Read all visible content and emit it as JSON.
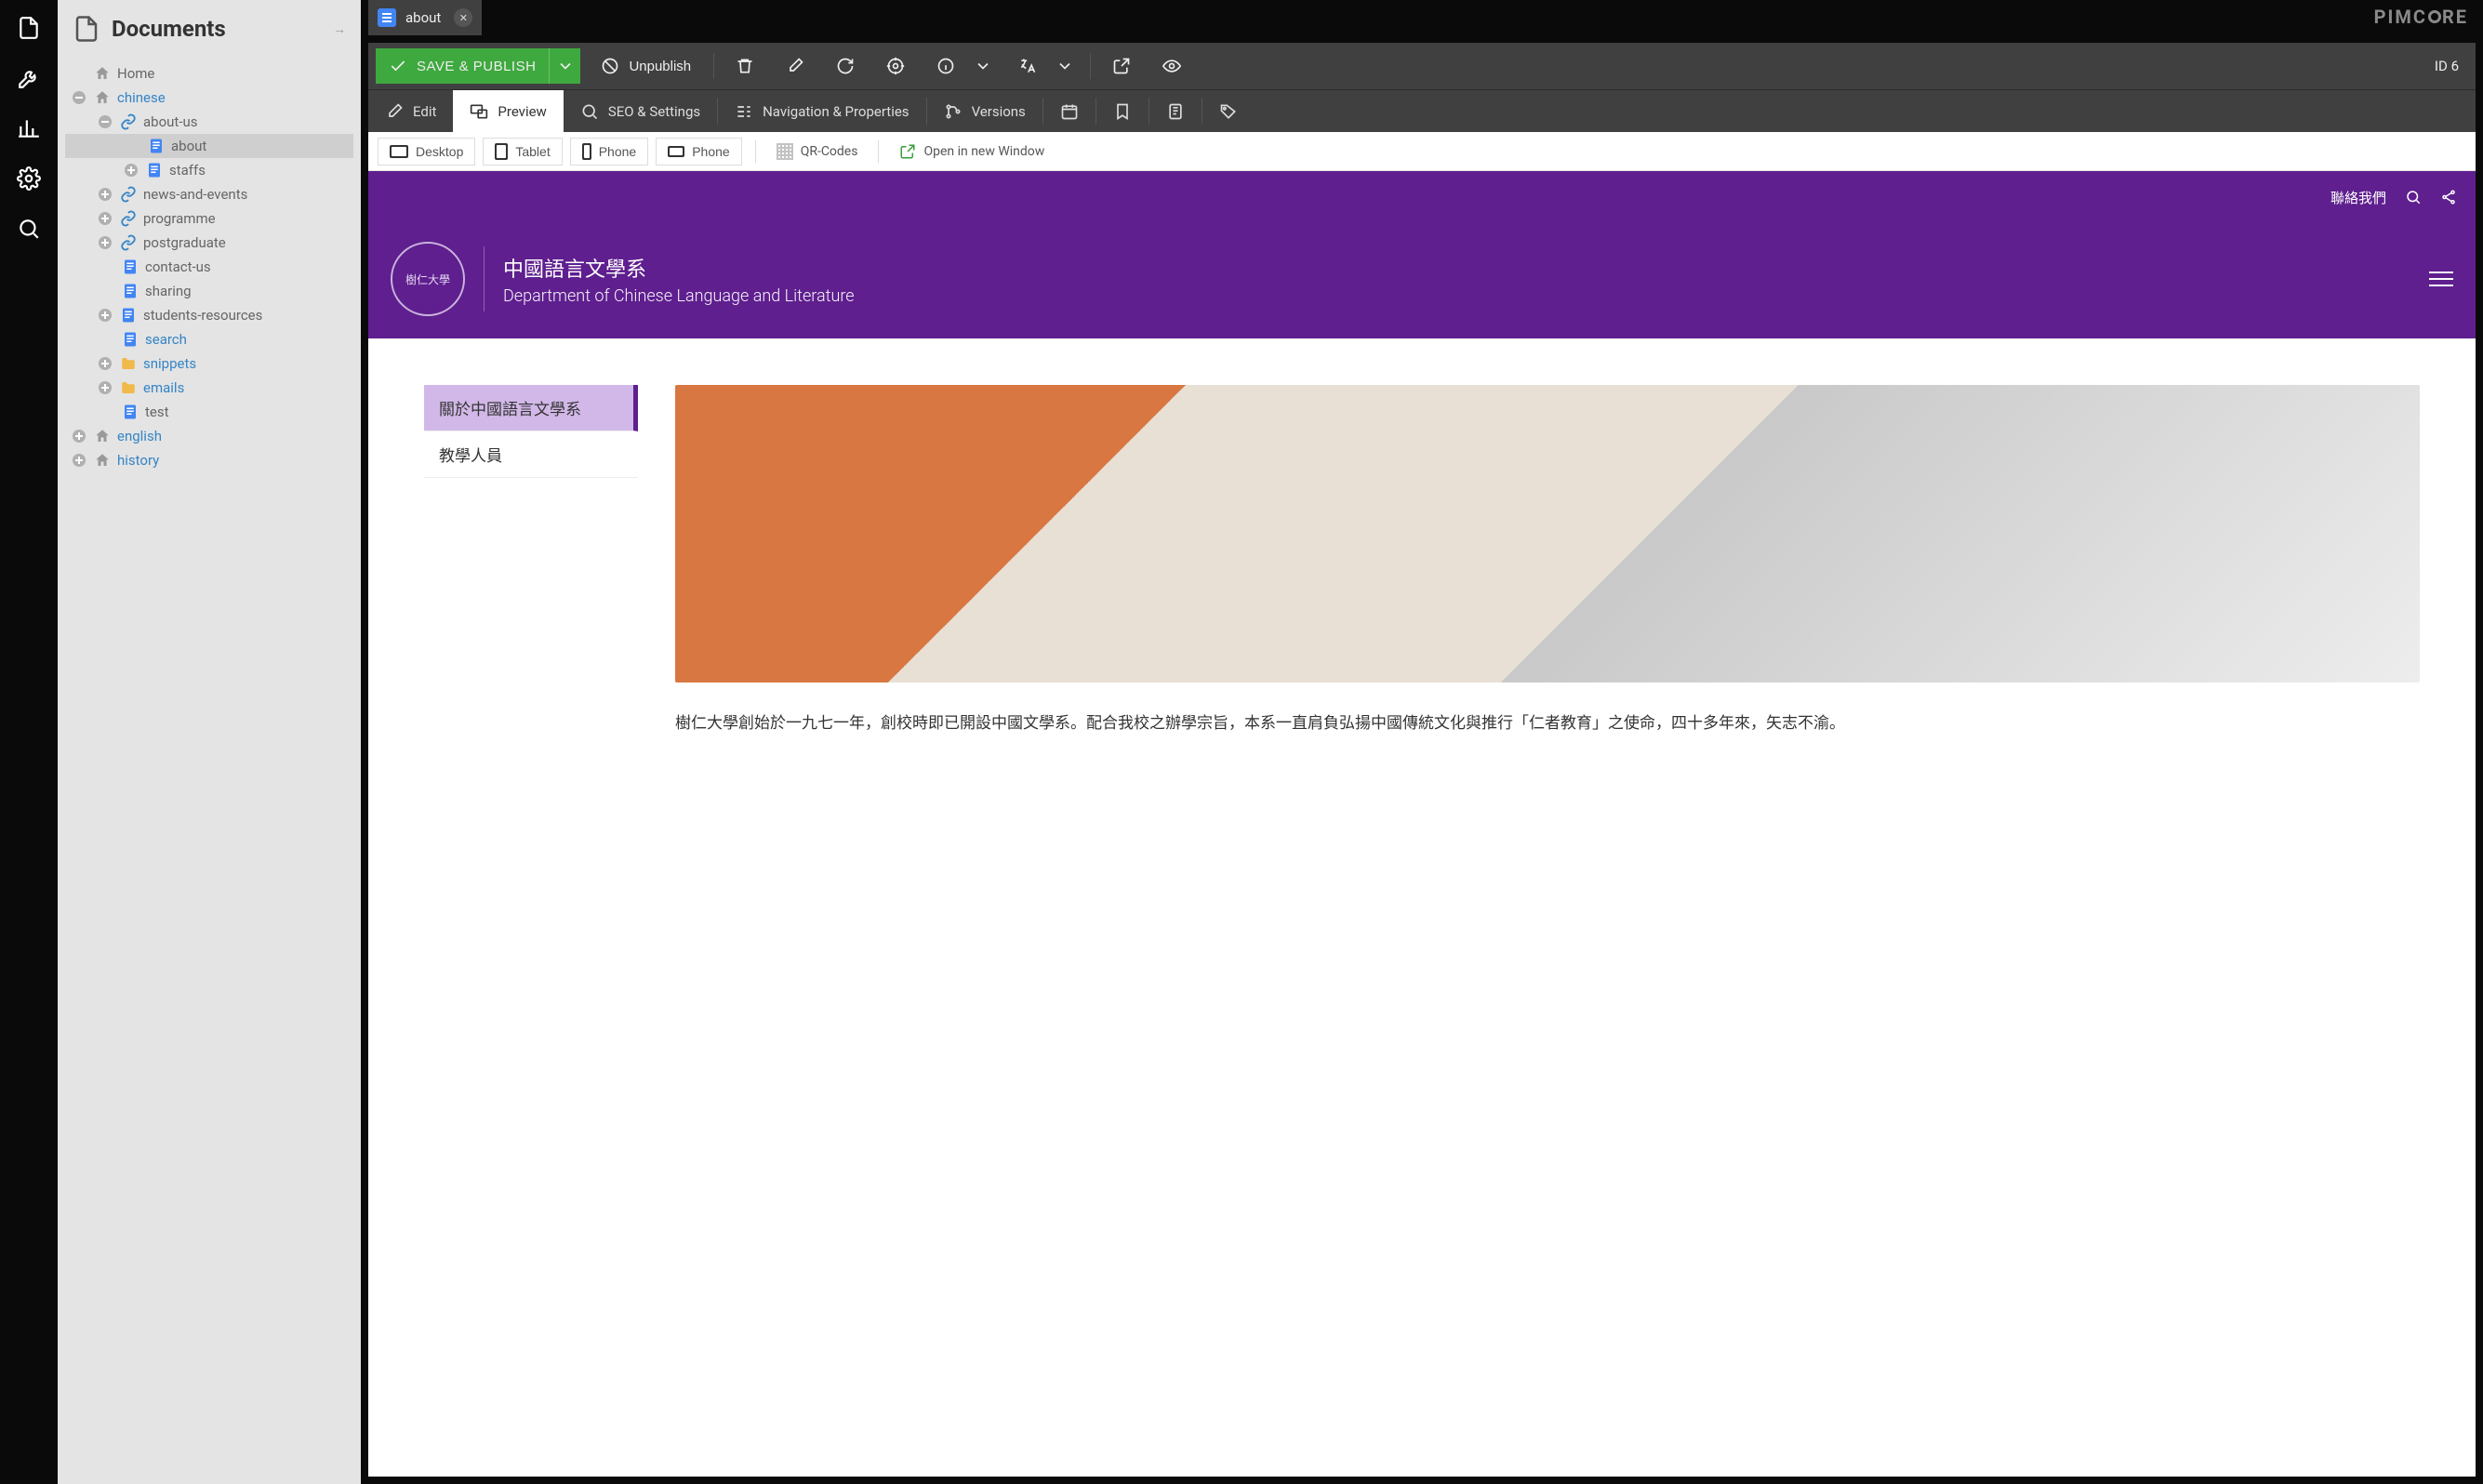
{
  "brand": "PIMCORE",
  "leftRail": [
    "documents",
    "tools",
    "analytics",
    "settings",
    "search"
  ],
  "sidebar": {
    "title": "Documents",
    "tree": {
      "home": "Home",
      "chinese": "chinese",
      "about_us": "about-us",
      "about": "about",
      "staffs": "staffs",
      "news": "news-and-events",
      "programme": "programme",
      "postgraduate": "postgraduate",
      "contact": "contact-us",
      "sharing": "sharing",
      "students_resources": "students-resources",
      "search": "search",
      "snippets": "snippets",
      "emails": "emails",
      "test": "test",
      "english": "english",
      "history": "history"
    }
  },
  "openTab": {
    "label": "about"
  },
  "actions": {
    "save": "SAVE & PUBLISH",
    "unpublish": "Unpublish",
    "id": "ID 6"
  },
  "secTabs": {
    "edit": "Edit",
    "preview": "Preview",
    "seo": "SEO & Settings",
    "nav": "Navigation & Properties",
    "versions": "Versions"
  },
  "previewBar": {
    "desktop": "Desktop",
    "tablet": "Tablet",
    "phone1": "Phone",
    "phone2": "Phone",
    "qr": "QR-Codes",
    "open": "Open in new Window"
  },
  "site": {
    "contact": "聯絡我們",
    "logoText": "樹仁大學",
    "titleZh": "中國語言文學系",
    "titleEn": "Department of Chinese Language and Literature",
    "menu": {
      "about": "關於中國語言文學系",
      "staff": "教學人員"
    },
    "body": "樹仁大學創始於一九七一年，創校時即已開設中國文學系。配合我校之辦學宗旨，本系一直肩負弘揚中國傳統文化與推行「仁者教育」之使命，四十多年來，矢志不渝。"
  }
}
